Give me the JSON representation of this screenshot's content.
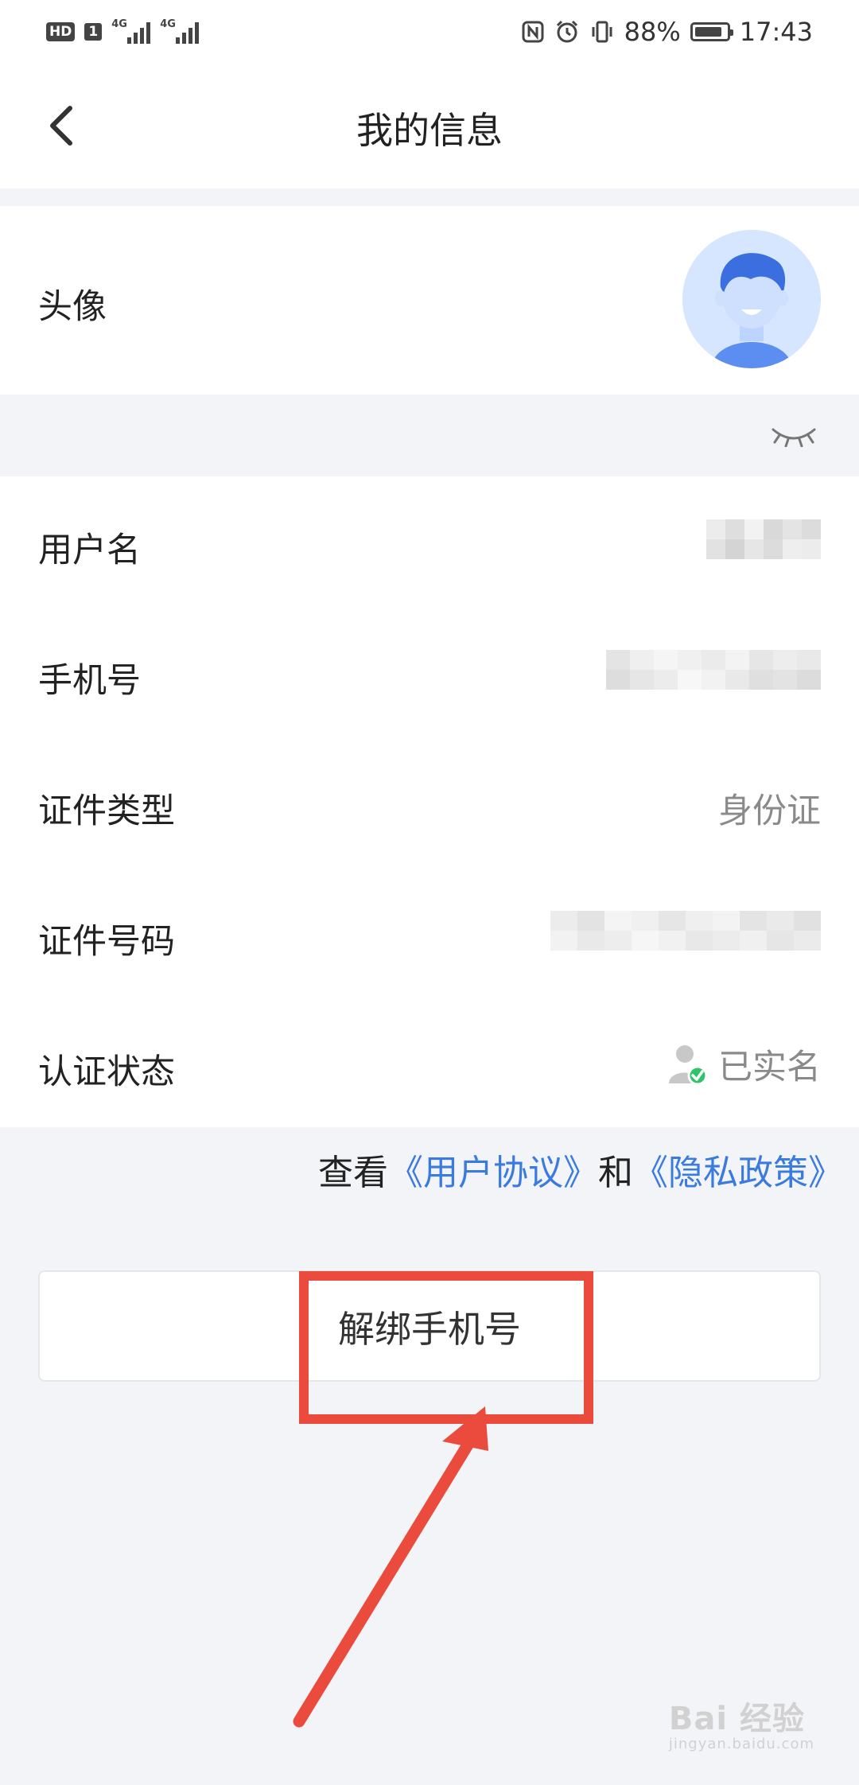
{
  "status_bar": {
    "hd_label": "HD",
    "sim_label": "1",
    "network_1": "4G",
    "network_2": "4G",
    "battery_percent": "88%",
    "battery_level": 0.88,
    "time": "17:43",
    "icons": [
      "nfc-icon",
      "alarm-icon",
      "vibrate-icon"
    ]
  },
  "header": {
    "title": "我的信息"
  },
  "profile": {
    "avatar_label": "头像",
    "avatar_colors": {
      "bg": "#d6e6ff",
      "face": "#bcd4ff",
      "hair": "#3b6fe0",
      "shirt": "#5b8ef0"
    }
  },
  "info": {
    "username_label": "用户名",
    "phone_label": "手机号",
    "id_type_label": "证件类型",
    "id_type_value": "身份证",
    "id_number_label": "证件号码",
    "verify_label": "认证状态",
    "verify_value": "已实名"
  },
  "agreement": {
    "prefix": "查看",
    "user_agreement": "《用户协议》",
    "conjunction": "和",
    "privacy_policy": "《隐私政策》"
  },
  "actions": {
    "unbind_phone": "解绑手机号"
  },
  "watermark": {
    "brand": "Bai 经验",
    "url": "jingyan.baidu.com"
  },
  "colors": {
    "accent_link": "#3a7be0",
    "annotation_red": "#ea4b3d",
    "page_bg": "#f3f4f8"
  }
}
